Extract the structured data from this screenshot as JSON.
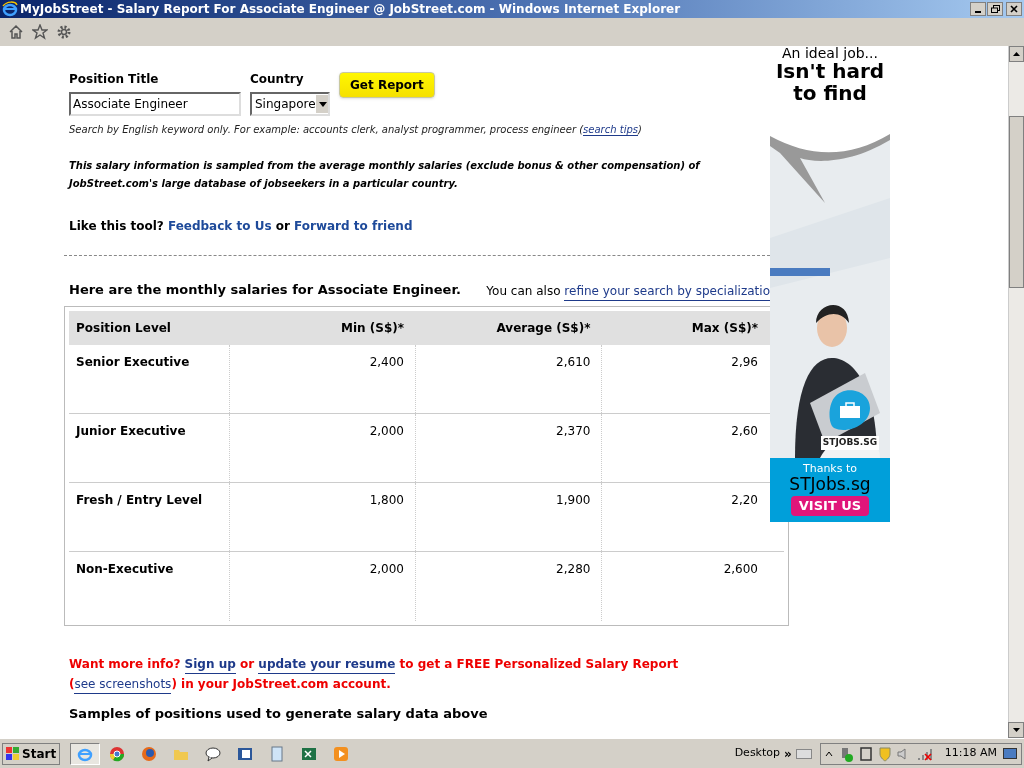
{
  "window": {
    "title": "MyJobStreet - Salary Report For Associate Engineer @ JobStreet.com - Windows Internet Explorer"
  },
  "form": {
    "position_label": "Position Title",
    "position_value": "Associate Engineer",
    "country_label": "Country",
    "country_value": "Singapore",
    "button": "Get Report",
    "hint": [
      {
        "kind": "text",
        "text": "Search by English keyword only. For example: accounts clerk, analyst programmer, process engineer ("
      },
      {
        "kind": "link",
        "text": "search tips"
      },
      {
        "kind": "text",
        "text": ")"
      }
    ],
    "notice": "This salary information is sampled from the average monthly salaries (exclude bonus & other compensation) of JobStreet.com's large database of jobseekers in a particular country."
  },
  "feedback": [
    {
      "kind": "text",
      "text": "Like this tool? "
    },
    {
      "kind": "link",
      "text": "Feedback to Us"
    },
    {
      "kind": "text",
      "text": " or "
    },
    {
      "kind": "link",
      "text": "Forward to friend"
    }
  ],
  "results": {
    "heading": "Here are the monthly salaries for Associate Engineer.",
    "refine_prefix": "You can also ",
    "refine_link": "refine your search by specializatio"
  },
  "table": {
    "columns": [
      "Position Level",
      "Min (S$)*",
      "Average (S$)*",
      "Max (S$)*"
    ],
    "rows": [
      [
        "Senior Executive",
        "2,400",
        "2,610",
        "2,96"
      ],
      [
        "Junior Executive",
        "2,000",
        "2,370",
        "2,60"
      ],
      [
        "Fresh / Entry Level",
        "1,800",
        "1,900",
        "2,20"
      ],
      [
        "Non-Executive",
        "2,000",
        "2,280",
        "2,600"
      ]
    ]
  },
  "promo": [
    {
      "kind": "text",
      "text": "Want more info? "
    },
    {
      "kind": "link",
      "text": "Sign up"
    },
    {
      "kind": "text",
      "text": " or "
    },
    {
      "kind": "link",
      "text": "update your resume"
    },
    {
      "kind": "text",
      "text": " to get a FREE Personalized Salary Report ("
    },
    {
      "kind": "plainlink",
      "text": "see screenshots"
    },
    {
      "kind": "text",
      "text": ") in your JobStreet.com account."
    }
  ],
  "samples_heading": "Samples of positions used to generate salary data above",
  "ad": {
    "line1": "An ideal job...",
    "line2": "Isn't hard to find",
    "brand": "STJOBS.SG",
    "thanks": "Thanks to",
    "site": "STJobs.sg",
    "button": "VISIT US"
  },
  "taskbar": {
    "start": "Start",
    "apps": [
      {
        "kind": "ie",
        "selected": true
      },
      {
        "kind": "chrome",
        "selected": false
      },
      {
        "kind": "firefox",
        "selected": false
      },
      {
        "kind": "folder",
        "selected": false
      },
      {
        "kind": "chat",
        "selected": false
      },
      {
        "kind": "word",
        "selected": false
      },
      {
        "kind": "notepad",
        "selected": false
      },
      {
        "kind": "excel",
        "selected": false
      },
      {
        "kind": "player",
        "selected": false
      }
    ],
    "desktop": "Desktop",
    "chevron": "»",
    "clock": "11:18 AM"
  }
}
